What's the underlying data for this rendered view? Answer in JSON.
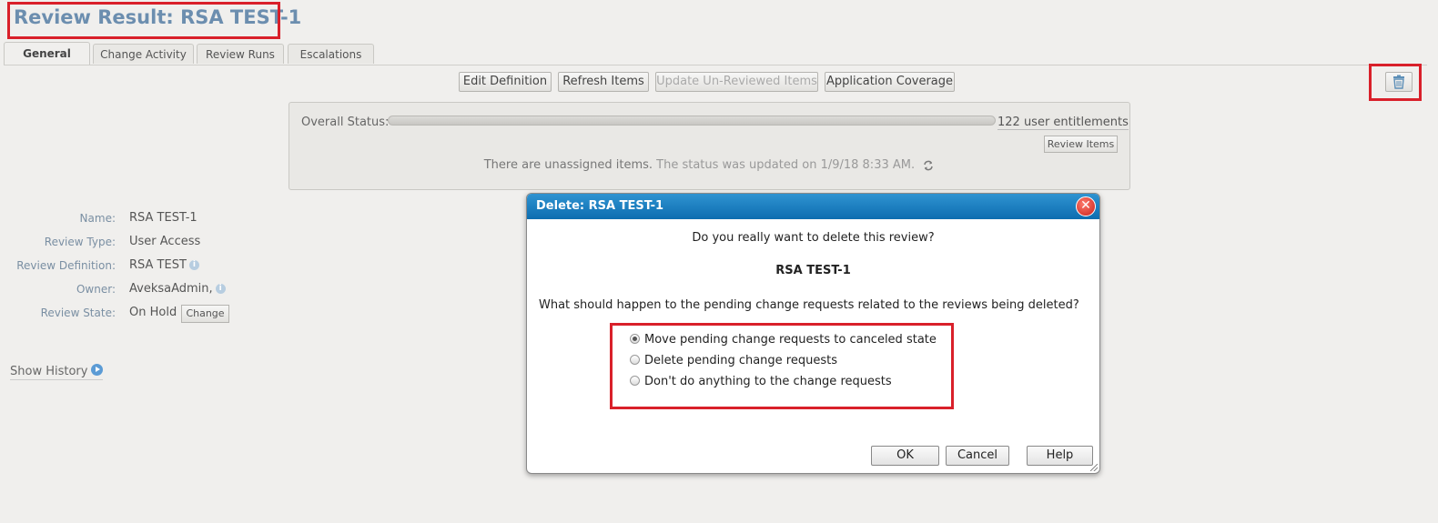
{
  "page": {
    "title": "Review Result: RSA TEST-1"
  },
  "tabs": [
    {
      "label": "General",
      "active": true
    },
    {
      "label": "Change Activity",
      "active": false
    },
    {
      "label": "Review Runs",
      "active": false
    },
    {
      "label": "Escalations",
      "active": false
    }
  ],
  "toolbar": {
    "edit_definition": "Edit Definition",
    "refresh_items": "Refresh Items",
    "update_unreviewed": "Update Un-Reviewed Items",
    "application_coverage": "Application Coverage",
    "delete_icon": "trash-icon"
  },
  "status": {
    "label": "Overall Status:",
    "entitlements": "122 user entitlements",
    "review_items": "Review Items",
    "unassigned": "There are unassigned items.",
    "updated": "The status was updated on 1/9/18 8:33 AM.",
    "refresh_icon": "refresh-icon"
  },
  "details": {
    "name_label": "Name:",
    "name_value": "RSA TEST-1",
    "type_label": "Review Type:",
    "type_value": "User Access",
    "definition_label": "Review Definition:",
    "definition_value": "RSA TEST",
    "owner_label": "Owner:",
    "owner_value": "AveksaAdmin,",
    "state_label": "Review State:",
    "state_value": "On Hold",
    "change_button": "Change",
    "show_history": "Show History"
  },
  "dialog": {
    "title": "Delete: RSA TEST-1",
    "question": "Do you really want to delete this review?",
    "review_name": "RSA TEST-1",
    "pending_question": "What should happen to the pending change requests related to the reviews being deleted?",
    "options": [
      {
        "label": "Move pending change requests to canceled state",
        "selected": true
      },
      {
        "label": "Delete pending change requests",
        "selected": false
      },
      {
        "label": "Don't do anything to the change requests",
        "selected": false
      }
    ],
    "ok": "OK",
    "cancel": "Cancel",
    "help": "Help"
  },
  "colors": {
    "highlight": "#d9202a",
    "title": "#6c8eaf",
    "dialog_header": "#0d6db0"
  }
}
